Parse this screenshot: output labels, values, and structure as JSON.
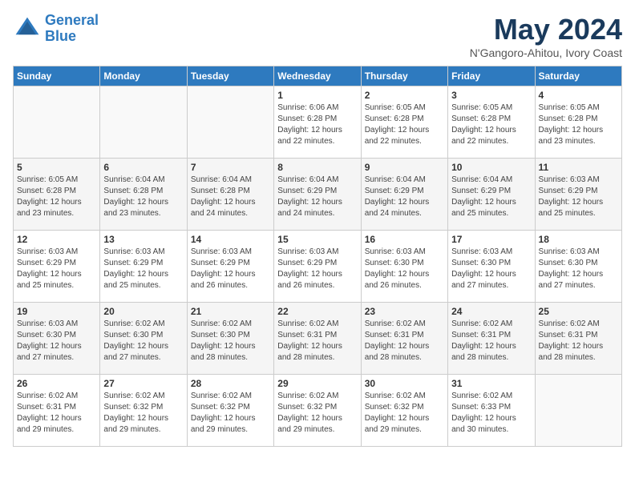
{
  "header": {
    "logo_line1": "General",
    "logo_line2": "Blue",
    "month": "May 2024",
    "location": "N'Gangoro-Ahitou, Ivory Coast"
  },
  "weekdays": [
    "Sunday",
    "Monday",
    "Tuesday",
    "Wednesday",
    "Thursday",
    "Friday",
    "Saturday"
  ],
  "weeks": [
    [
      {
        "day": "",
        "sunrise": "",
        "sunset": "",
        "daylight": ""
      },
      {
        "day": "",
        "sunrise": "",
        "sunset": "",
        "daylight": ""
      },
      {
        "day": "",
        "sunrise": "",
        "sunset": "",
        "daylight": ""
      },
      {
        "day": "1",
        "sunrise": "6:06 AM",
        "sunset": "6:28 PM",
        "daylight": "12 hours and 22 minutes."
      },
      {
        "day": "2",
        "sunrise": "6:05 AM",
        "sunset": "6:28 PM",
        "daylight": "12 hours and 22 minutes."
      },
      {
        "day": "3",
        "sunrise": "6:05 AM",
        "sunset": "6:28 PM",
        "daylight": "12 hours and 22 minutes."
      },
      {
        "day": "4",
        "sunrise": "6:05 AM",
        "sunset": "6:28 PM",
        "daylight": "12 hours and 23 minutes."
      }
    ],
    [
      {
        "day": "5",
        "sunrise": "6:05 AM",
        "sunset": "6:28 PM",
        "daylight": "12 hours and 23 minutes."
      },
      {
        "day": "6",
        "sunrise": "6:04 AM",
        "sunset": "6:28 PM",
        "daylight": "12 hours and 23 minutes."
      },
      {
        "day": "7",
        "sunrise": "6:04 AM",
        "sunset": "6:28 PM",
        "daylight": "12 hours and 24 minutes."
      },
      {
        "day": "8",
        "sunrise": "6:04 AM",
        "sunset": "6:29 PM",
        "daylight": "12 hours and 24 minutes."
      },
      {
        "day": "9",
        "sunrise": "6:04 AM",
        "sunset": "6:29 PM",
        "daylight": "12 hours and 24 minutes."
      },
      {
        "day": "10",
        "sunrise": "6:04 AM",
        "sunset": "6:29 PM",
        "daylight": "12 hours and 25 minutes."
      },
      {
        "day": "11",
        "sunrise": "6:03 AM",
        "sunset": "6:29 PM",
        "daylight": "12 hours and 25 minutes."
      }
    ],
    [
      {
        "day": "12",
        "sunrise": "6:03 AM",
        "sunset": "6:29 PM",
        "daylight": "12 hours and 25 minutes."
      },
      {
        "day": "13",
        "sunrise": "6:03 AM",
        "sunset": "6:29 PM",
        "daylight": "12 hours and 25 minutes."
      },
      {
        "day": "14",
        "sunrise": "6:03 AM",
        "sunset": "6:29 PM",
        "daylight": "12 hours and 26 minutes."
      },
      {
        "day": "15",
        "sunrise": "6:03 AM",
        "sunset": "6:29 PM",
        "daylight": "12 hours and 26 minutes."
      },
      {
        "day": "16",
        "sunrise": "6:03 AM",
        "sunset": "6:30 PM",
        "daylight": "12 hours and 26 minutes."
      },
      {
        "day": "17",
        "sunrise": "6:03 AM",
        "sunset": "6:30 PM",
        "daylight": "12 hours and 27 minutes."
      },
      {
        "day": "18",
        "sunrise": "6:03 AM",
        "sunset": "6:30 PM",
        "daylight": "12 hours and 27 minutes."
      }
    ],
    [
      {
        "day": "19",
        "sunrise": "6:03 AM",
        "sunset": "6:30 PM",
        "daylight": "12 hours and 27 minutes."
      },
      {
        "day": "20",
        "sunrise": "6:02 AM",
        "sunset": "6:30 PM",
        "daylight": "12 hours and 27 minutes."
      },
      {
        "day": "21",
        "sunrise": "6:02 AM",
        "sunset": "6:30 PM",
        "daylight": "12 hours and 28 minutes."
      },
      {
        "day": "22",
        "sunrise": "6:02 AM",
        "sunset": "6:31 PM",
        "daylight": "12 hours and 28 minutes."
      },
      {
        "day": "23",
        "sunrise": "6:02 AM",
        "sunset": "6:31 PM",
        "daylight": "12 hours and 28 minutes."
      },
      {
        "day": "24",
        "sunrise": "6:02 AM",
        "sunset": "6:31 PM",
        "daylight": "12 hours and 28 minutes."
      },
      {
        "day": "25",
        "sunrise": "6:02 AM",
        "sunset": "6:31 PM",
        "daylight": "12 hours and 28 minutes."
      }
    ],
    [
      {
        "day": "26",
        "sunrise": "6:02 AM",
        "sunset": "6:31 PM",
        "daylight": "12 hours and 29 minutes."
      },
      {
        "day": "27",
        "sunrise": "6:02 AM",
        "sunset": "6:32 PM",
        "daylight": "12 hours and 29 minutes."
      },
      {
        "day": "28",
        "sunrise": "6:02 AM",
        "sunset": "6:32 PM",
        "daylight": "12 hours and 29 minutes."
      },
      {
        "day": "29",
        "sunrise": "6:02 AM",
        "sunset": "6:32 PM",
        "daylight": "12 hours and 29 minutes."
      },
      {
        "day": "30",
        "sunrise": "6:02 AM",
        "sunset": "6:32 PM",
        "daylight": "12 hours and 29 minutes."
      },
      {
        "day": "31",
        "sunrise": "6:02 AM",
        "sunset": "6:33 PM",
        "daylight": "12 hours and 30 minutes."
      },
      {
        "day": "",
        "sunrise": "",
        "sunset": "",
        "daylight": ""
      }
    ]
  ]
}
